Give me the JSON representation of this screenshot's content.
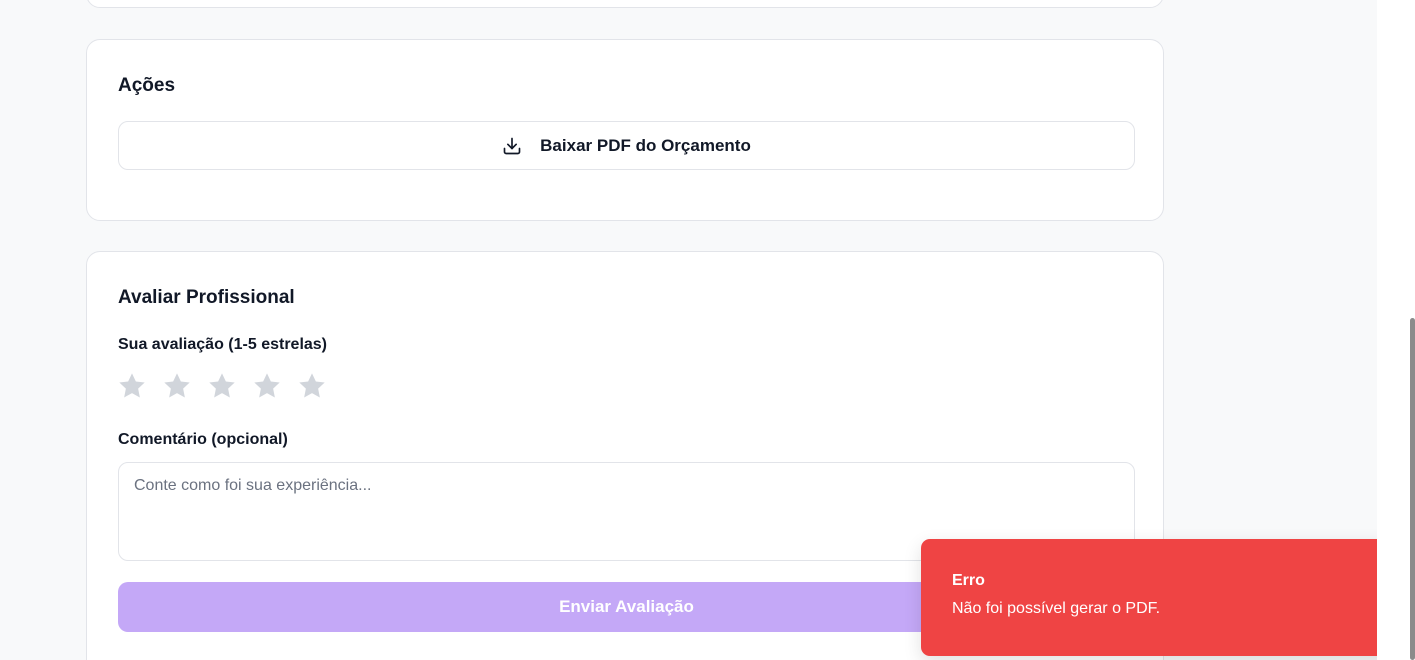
{
  "actions": {
    "title": "Ações",
    "download_label": "Baixar PDF do Orçamento",
    "download_icon": "download-icon"
  },
  "rating": {
    "title": "Avaliar Profissional",
    "rating_label": "Sua avaliação (1-5 estrelas)",
    "stars_selected": 0,
    "stars_total": 5,
    "star_color_empty": "#d1d5db",
    "comment_label": "Comentário (opcional)",
    "comment_placeholder": "Conte como foi sua experiência...",
    "comment_value": "",
    "submit_label": "Enviar Avaliação",
    "submit_color": "#c4a8f7"
  },
  "toast": {
    "title": "Erro",
    "message": "Não foi possível gerar o PDF.",
    "color": "#ef4444"
  }
}
